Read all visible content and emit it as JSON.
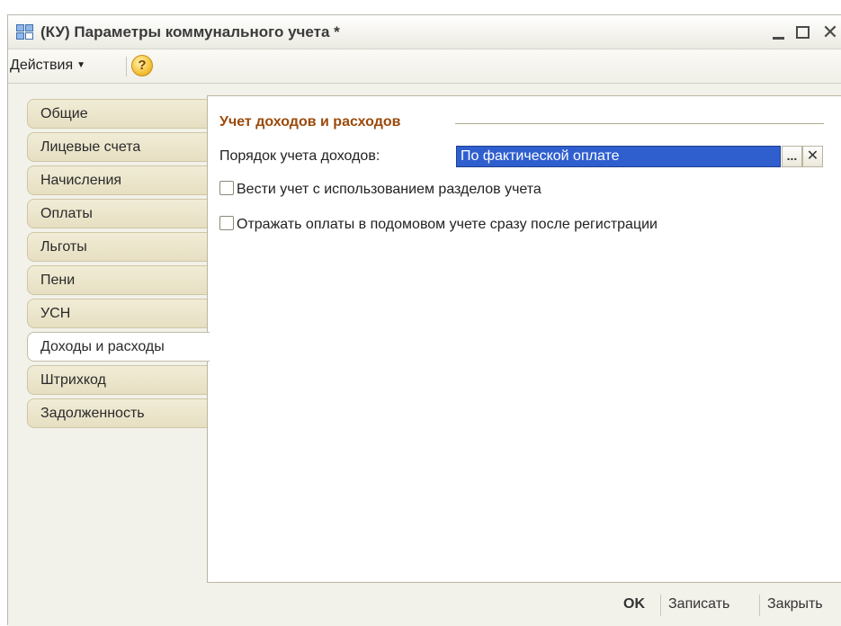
{
  "window": {
    "title": "(КУ) Параметры коммунального учета *",
    "minimize_label": "_",
    "maximize_label": "□",
    "close_label": "✕"
  },
  "toolbar": {
    "actions_label": "Действия",
    "help_label": "?"
  },
  "tabs": [
    {
      "label": "Общие"
    },
    {
      "label": "Лицевые счета"
    },
    {
      "label": "Начисления"
    },
    {
      "label": "Оплаты"
    },
    {
      "label": "Льготы"
    },
    {
      "label": "Пени"
    },
    {
      "label": "УСН"
    },
    {
      "label": "Доходы и расходы",
      "active": true
    },
    {
      "label": "Штрихкод"
    },
    {
      "label": "Задолженность"
    }
  ],
  "panel": {
    "group_title": "Учет доходов и расходов",
    "income_order_label": "Порядок учета доходов:",
    "income_order_value": "По фактической оплате",
    "pick_label": "...",
    "clear_label": "✕",
    "checkbox1_label": "Вести учет с использованием разделов учета",
    "checkbox1_checked": false,
    "checkbox2_label": "Отражать оплаты в подомовом учете сразу после регистрации",
    "checkbox2_checked": false
  },
  "buttons": {
    "ok_label": "OK",
    "save_label": "Записать",
    "close_label": "Закрыть"
  },
  "colors": {
    "accent_title": "#9c4a0a",
    "selection": "#2f5fcf",
    "tab_bg": "#e6dfc2"
  }
}
